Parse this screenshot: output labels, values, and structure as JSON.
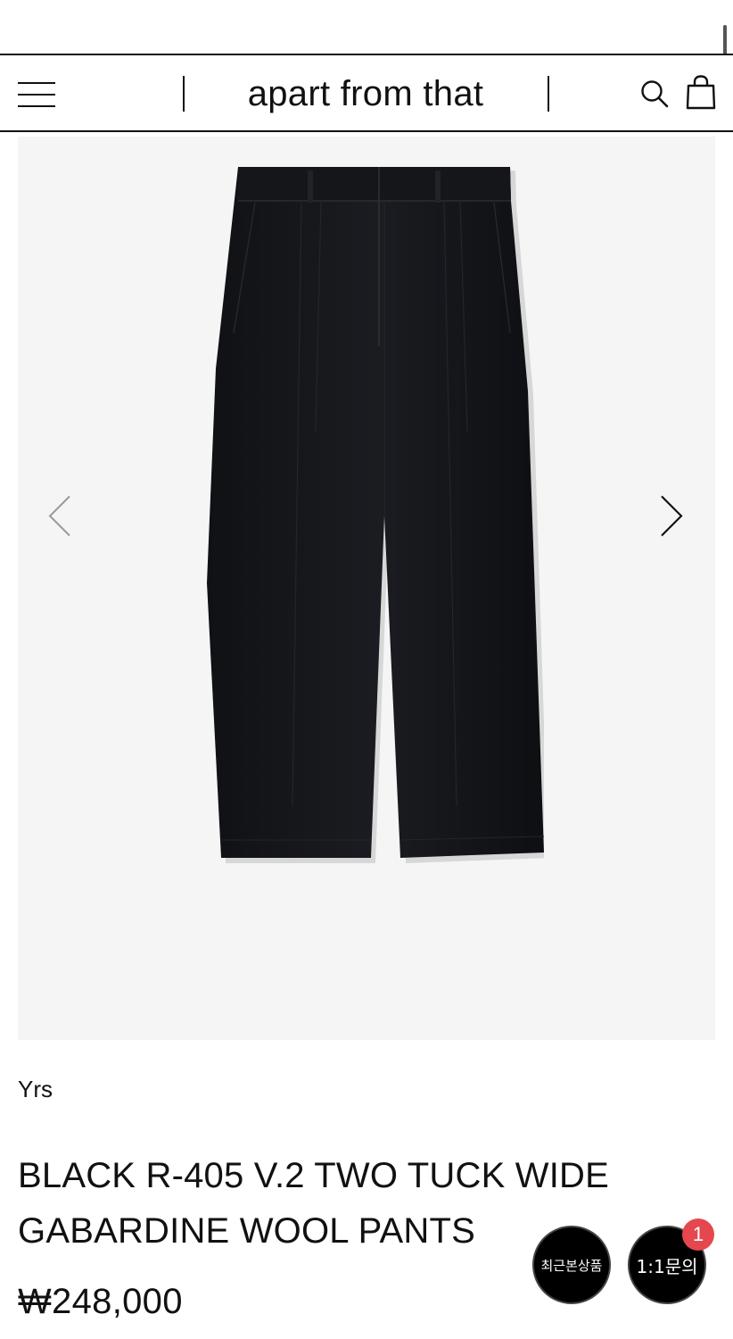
{
  "header": {
    "brand": "apart from that",
    "menu_icon": "hamburger-menu-icon",
    "search_icon": "search-icon",
    "cart_icon": "shopping-bag-icon"
  },
  "gallery": {
    "prev_icon": "chevron-left-icon",
    "next_icon": "chevron-right-icon",
    "image": "black-wide-pants-image"
  },
  "product": {
    "brand": "Yrs",
    "title_line1": "BLACK R-405 V.2 TWO TUCK WIDE",
    "title_line2": "GABARDINE WOOL PANTS",
    "price": "₩248,000"
  },
  "floating": {
    "recent_label": "최근본상품",
    "inquiry_label": "1:1문의",
    "inquiry_badge": "1"
  },
  "colors": {
    "text": "#111111",
    "gallery_bg": "#f5f5f5",
    "badge": "#e5474f",
    "product": "#17181c"
  }
}
